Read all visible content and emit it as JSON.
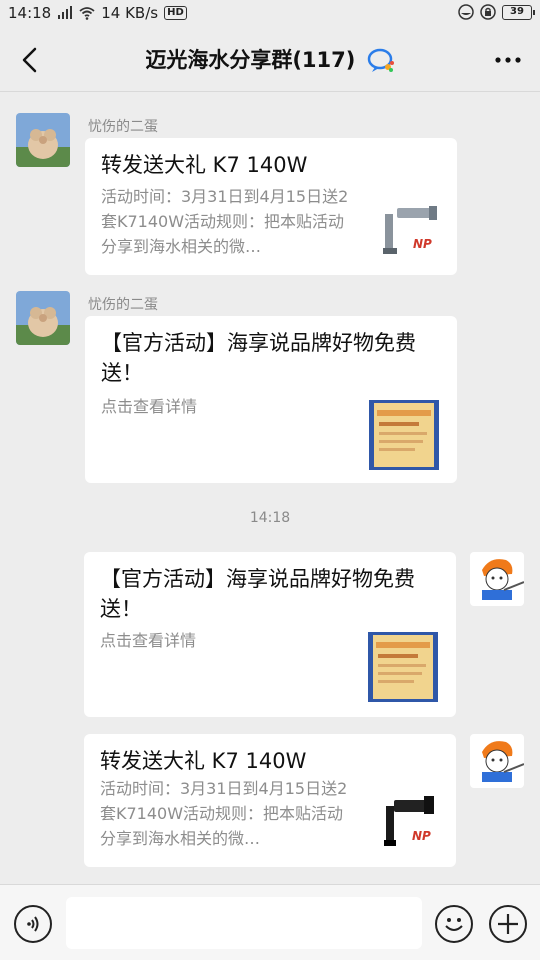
{
  "status_bar": {
    "time": "14:18",
    "network_speed": "14 KB/s",
    "hd_label": "HD",
    "battery": "39"
  },
  "header": {
    "title": "迈光海水分享群(117)"
  },
  "messages": [
    {
      "sender": "忧伤的二蛋",
      "title": "转发送大礼 K7 140W",
      "desc": "活动时间：3月31日到4月15日送2套K7140W活动规则：把本贴活动分享到海水相关的微…",
      "thumb": "light-fixture-thumbnail"
    },
    {
      "sender": "忧伤的二蛋",
      "title": "【官方活动】海享说品牌好物免费送！",
      "desc": "点击查看详情",
      "thumb": "poster-thumbnail"
    },
    {
      "title": "【官方活动】海享说品牌好物免费送！",
      "desc": "点击查看详情",
      "thumb": "poster-thumbnail"
    },
    {
      "title": "转发送大礼 K7 140W",
      "desc": "活动时间：3月31日到4月15日送2套K7140W活动规则：把本贴活动分享到海水相关的微…",
      "thumb": "light-fixture-thumbnail"
    }
  ],
  "timestamp": "14:18",
  "input": {
    "value": ""
  },
  "colors": {
    "background": "#ededed",
    "card": "#ffffff",
    "muted_text": "#8d8d8d"
  }
}
